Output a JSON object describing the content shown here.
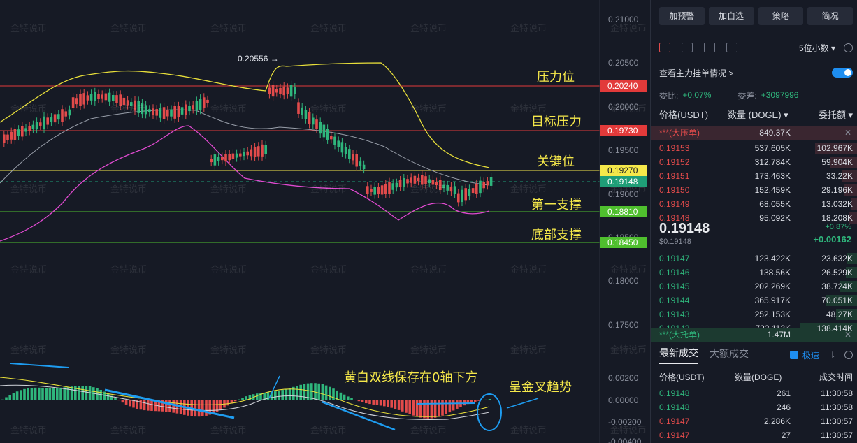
{
  "chart": {
    "peak_label": "0.20556 →",
    "axis_ticks": [
      "0.21000",
      "0.20500",
      "0.20000",
      "0.19500",
      "0.19000",
      "0.18500",
      "0.18000",
      "0.17500",
      "0.00200",
      "0.00000",
      "-0.00200",
      "-0.00400"
    ],
    "levels": [
      {
        "price": "0.20240",
        "annotation": "压力位",
        "color": "#e23a3a"
      },
      {
        "price": "0.19730",
        "annotation": "目标压力",
        "color": "#e23a3a"
      },
      {
        "price": "0.19270",
        "annotation": "关键位",
        "color": "#f5e84a"
      },
      {
        "price": "0.19148",
        "annotation": "",
        "color": "#1f9e77"
      },
      {
        "price": "0.18810",
        "annotation": "第一支撑",
        "color": "#4fbf2e"
      },
      {
        "price": "0.18450",
        "annotation": "底部支撑",
        "color": "#4fbf2e"
      }
    ],
    "macd_notes": [
      "黄白双线保存在0轴下方",
      "呈金叉趋势"
    ],
    "watermark": "金特说币"
  },
  "panel": {
    "buttons": [
      "加预警",
      "加自选",
      "策略",
      "简况"
    ],
    "precision": "5位小数 ▾",
    "main_order_label": "查看主力挂单情况 >",
    "ratio_label": "委比:",
    "ratio_value": "+0.07%",
    "diff_label": "委差:",
    "diff_value": "+3097996",
    "book_headers": [
      "价格(USDT)",
      "数量 (DOGE) ▾",
      "委托额 ▾"
    ],
    "big_ask_label": "***(大压单)",
    "big_ask_value": "849.37K",
    "asks": [
      {
        "price": "0.19153",
        "qty": "537.605K",
        "total": "102.967K",
        "fill": 0.55
      },
      {
        "price": "0.19152",
        "qty": "312.784K",
        "total": "59.904K",
        "fill": 0.35
      },
      {
        "price": "0.19151",
        "qty": "173.463K",
        "total": "33.22K",
        "fill": 0.2
      },
      {
        "price": "0.19150",
        "qty": "152.459K",
        "total": "29.196K",
        "fill": 0.17
      },
      {
        "price": "0.19149",
        "qty": "68.055K",
        "total": "13.032K",
        "fill": 0.08
      },
      {
        "price": "0.19148",
        "qty": "95.092K",
        "total": "18.208K",
        "fill": 0.1
      }
    ],
    "last_price": "0.19148",
    "last_sub": "$0.19148",
    "change_pct": "+0.87%",
    "change_abs": "+0.00162",
    "bids": [
      {
        "price": "0.19147",
        "qty": "123.422K",
        "total": "23.632K",
        "fill": 0.14
      },
      {
        "price": "0.19146",
        "qty": "138.56K",
        "total": "26.529K",
        "fill": 0.15
      },
      {
        "price": "0.19145",
        "qty": "202.269K",
        "total": "38.724K",
        "fill": 0.22
      },
      {
        "price": "0.19144",
        "qty": "365.917K",
        "total": "70.051K",
        "fill": 0.4
      },
      {
        "price": "0.19143",
        "qty": "252.153K",
        "total": "48.27K",
        "fill": 0.27
      },
      {
        "price": "0.19142",
        "qty": "723.113K",
        "total": "138.414K",
        "fill": 0.75
      }
    ],
    "big_bid_label": "***(大托单)",
    "big_bid_value": "1.47M",
    "trade_tabs": [
      "最新成交",
      "大额成交"
    ],
    "fast_label": "极速",
    "trade_headers": [
      "价格(USDT)",
      "数量(DOGE)",
      "成交时间"
    ],
    "trades": [
      {
        "price": "0.19148",
        "qty": "261",
        "time": "11:30:58",
        "side": "bid"
      },
      {
        "price": "0.19148",
        "qty": "246",
        "time": "11:30:58",
        "side": "bid"
      },
      {
        "price": "0.19147",
        "qty": "2.286K",
        "time": "11:30:57",
        "side": "ask"
      },
      {
        "price": "0.19147",
        "qty": "27",
        "time": "11:30:57",
        "side": "ask"
      }
    ]
  }
}
